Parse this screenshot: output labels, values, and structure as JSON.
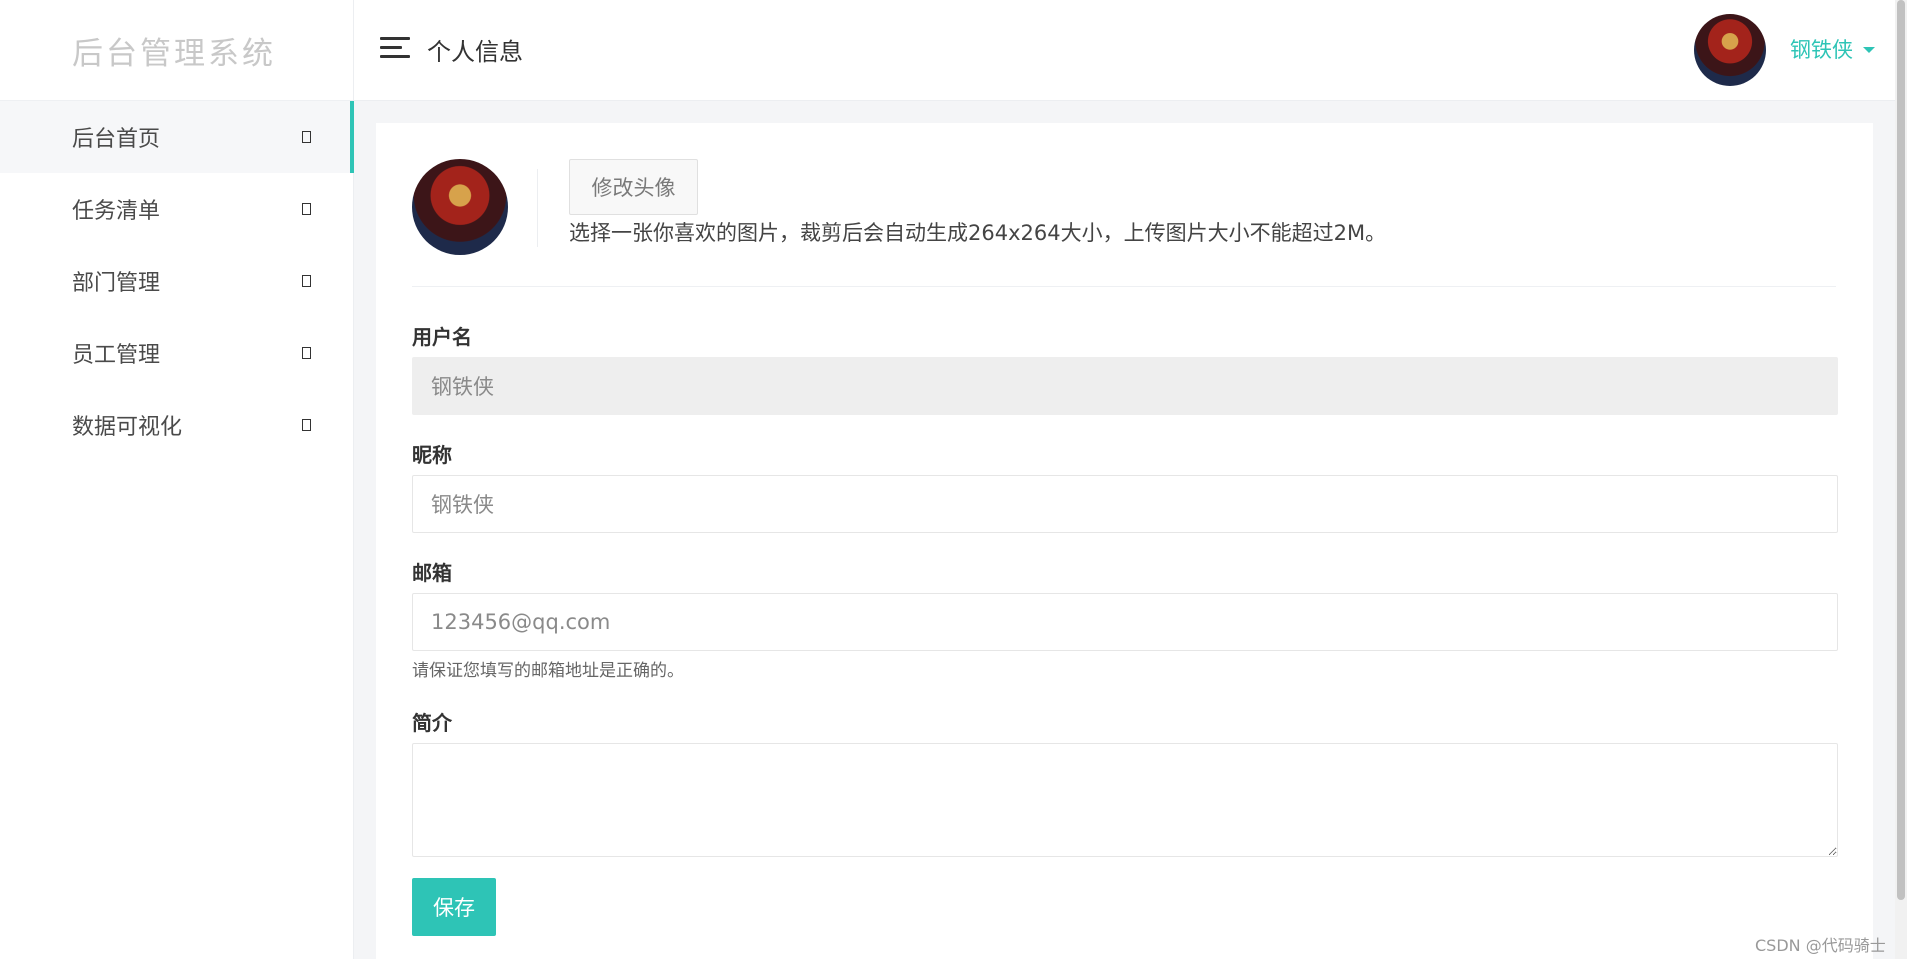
{
  "sidebar": {
    "logo": "后台管理系统",
    "items": [
      {
        "label": "后台首页",
        "active": true
      },
      {
        "label": "任务清单",
        "active": false
      },
      {
        "label": "部门管理",
        "active": false
      },
      {
        "label": "员工管理",
        "active": false
      },
      {
        "label": "数据可视化",
        "active": false
      }
    ]
  },
  "header": {
    "title": "个人信息",
    "user_name": "钢铁侠"
  },
  "profile": {
    "change_avatar_label": "修改头像",
    "avatar_hint": "选择一张你喜欢的图片，裁剪后会自动生成264x264大小，上传图片大小不能超过2M。",
    "username_label": "用户名",
    "username_value": "钢铁侠",
    "nickname_label": "昵称",
    "nickname_value": "钢铁侠",
    "email_label": "邮箱",
    "email_value": "123456@qq.com",
    "email_help": "请保证您填写的邮箱地址是正确的。",
    "bio_label": "简介",
    "bio_value": "",
    "save_label": "保存"
  },
  "watermark": "CSDN @代码骑士",
  "colors": {
    "accent": "#2ec4b6",
    "readonly_bg": "#eeeeee"
  },
  "icons": {
    "menu": "hamburger-menu-icon",
    "nav_indicator": "chevron-icon",
    "user_dropdown": "caret-down-icon"
  }
}
